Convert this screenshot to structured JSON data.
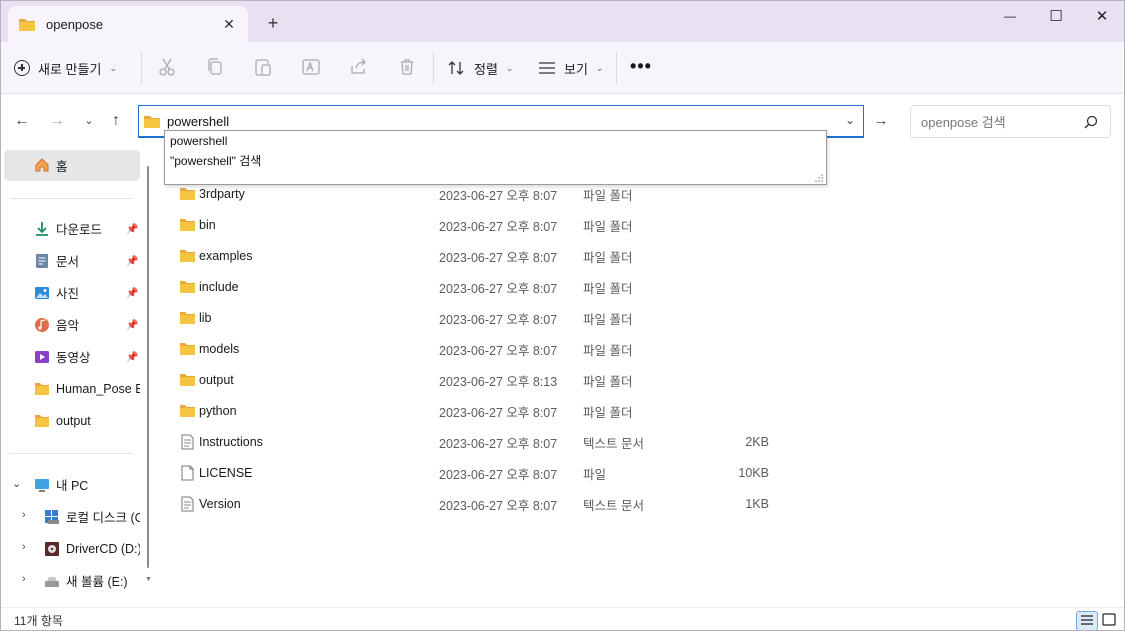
{
  "window": {
    "tab_title": "openpose",
    "new_tab": "+",
    "minimize": "—",
    "maximize": "☐",
    "close": "✕",
    "tab_close": "✕"
  },
  "toolbar": {
    "new_label": "새로 만들기",
    "sort_label": "정렬",
    "view_label": "보기",
    "more": "•••"
  },
  "address_bar": {
    "value": "powershell",
    "search_placeholder": "openpose 검색"
  },
  "autocomplete": {
    "items": [
      "powershell",
      "\"powershell\" 검색"
    ]
  },
  "sidebar": {
    "home": "홈",
    "quick_access": [
      {
        "label": "다운로드",
        "icon": "download-icon"
      },
      {
        "label": "문서",
        "icon": "document-icon"
      },
      {
        "label": "사진",
        "icon": "pictures-icon"
      },
      {
        "label": "음악",
        "icon": "music-icon"
      },
      {
        "label": "동영상",
        "icon": "video-icon"
      },
      {
        "label": "Human_Pose Es",
        "icon": "folder-icon"
      },
      {
        "label": "output",
        "icon": "folder-icon"
      }
    ],
    "this_pc": "내 PC",
    "drives": [
      {
        "label": "로컬 디스크 (C",
        "icon": "local-disk-icon"
      },
      {
        "label": "DriverCD (D:)",
        "icon": "cd-drive-icon"
      },
      {
        "label": "새 볼륨 (E:)",
        "icon": "volume-icon"
      }
    ]
  },
  "files": [
    {
      "name": "3rdparty",
      "date": "2023-06-27 오후 8:07",
      "type": "파일 폴더",
      "size": "",
      "kind": "folder"
    },
    {
      "name": "bin",
      "date": "2023-06-27 오후 8:07",
      "type": "파일 폴더",
      "size": "",
      "kind": "folder"
    },
    {
      "name": "examples",
      "date": "2023-06-27 오후 8:07",
      "type": "파일 폴더",
      "size": "",
      "kind": "folder"
    },
    {
      "name": "include",
      "date": "2023-06-27 오후 8:07",
      "type": "파일 폴더",
      "size": "",
      "kind": "folder"
    },
    {
      "name": "lib",
      "date": "2023-06-27 오후 8:07",
      "type": "파일 폴더",
      "size": "",
      "kind": "folder"
    },
    {
      "name": "models",
      "date": "2023-06-27 오후 8:07",
      "type": "파일 폴더",
      "size": "",
      "kind": "folder"
    },
    {
      "name": "output",
      "date": "2023-06-27 오후 8:13",
      "type": "파일 폴더",
      "size": "",
      "kind": "folder"
    },
    {
      "name": "python",
      "date": "2023-06-27 오후 8:07",
      "type": "파일 폴더",
      "size": "",
      "kind": "folder"
    },
    {
      "name": "Instructions",
      "date": "2023-06-27 오후 8:07",
      "type": "텍스트 문서",
      "size": "2KB",
      "kind": "text"
    },
    {
      "name": "LICENSE",
      "date": "2023-06-27 오후 8:07",
      "type": "파일",
      "size": "10KB",
      "kind": "file"
    },
    {
      "name": "Version",
      "date": "2023-06-27 오후 8:07",
      "type": "텍스트 문서",
      "size": "1KB",
      "kind": "text"
    }
  ],
  "status": {
    "item_count": "11개 항목"
  },
  "colors": {
    "accent": "#1f6fd0",
    "titlebar": "#e9e1f2",
    "folder": "#f3c13a"
  }
}
